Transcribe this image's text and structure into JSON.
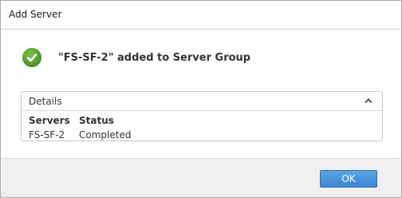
{
  "window": {
    "title": "Add Server"
  },
  "message": {
    "icon": "success-check-icon",
    "text": "\"FS-SF-2\" added to Server Group"
  },
  "details": {
    "header": "Details",
    "columns": [
      "Servers",
      "Status"
    ],
    "rows": [
      [
        "FS-SF-2",
        "Completed"
      ]
    ]
  },
  "footer": {
    "ok_label": "OK"
  },
  "colors": {
    "accent": "#3b86d1",
    "success": "#4f9a2a"
  }
}
